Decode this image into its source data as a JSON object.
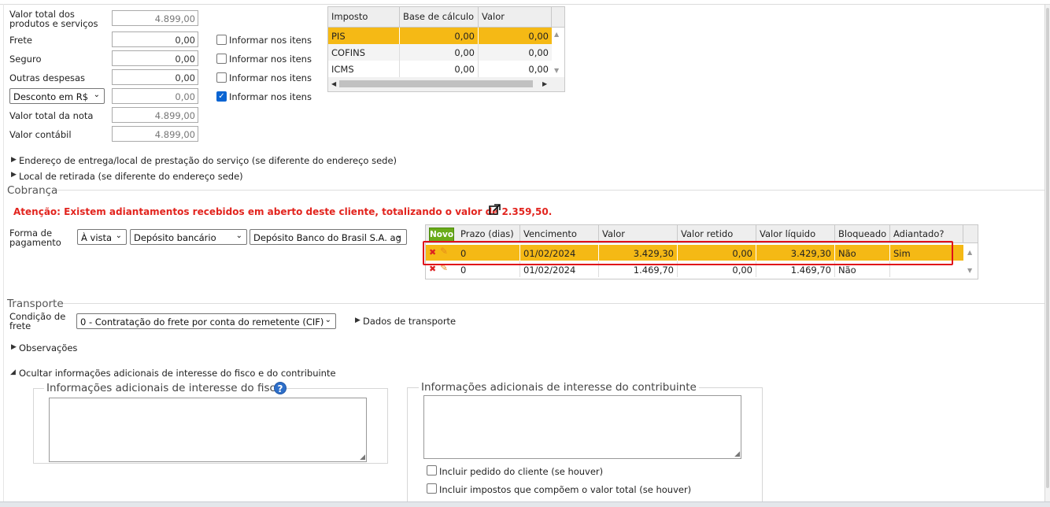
{
  "totals": {
    "valor_total_produtos_label": "Valor total dos produtos e serviços",
    "valor_total_produtos": "4.899,00",
    "frete_label": "Frete",
    "frete": "0,00",
    "seguro_label": "Seguro",
    "seguro": "0,00",
    "outras_label": "Outras despesas",
    "outras": "0,00",
    "desconto_select": "Desconto em R$",
    "desconto": "0,00",
    "valor_total_nota_label": "Valor total da nota",
    "valor_total_nota": "4.899,00",
    "valor_contabil_label": "Valor contábil",
    "valor_contabil": "4.899,00",
    "informar_label": "Informar nos itens"
  },
  "tax_grid": {
    "headers": [
      "Imposto",
      "Base de cálculo",
      "Valor"
    ],
    "rows": [
      {
        "imposto": "PIS",
        "base": "0,00",
        "valor": "0,00"
      },
      {
        "imposto": "COFINS",
        "base": "0,00",
        "valor": "0,00"
      },
      {
        "imposto": "ICMS",
        "base": "0,00",
        "valor": "0,00"
      }
    ]
  },
  "sections": {
    "endereco_entrega": "Endereço de entrega/local de prestação do serviço (se diferente do endereço sede)",
    "local_retirada": "Local de retirada (se diferente do endereço sede)",
    "cobranca": "Cobrança",
    "transporte": "Transporte",
    "observacoes": "Observações",
    "ocultar_info": "Ocultar informações adicionais de interesse do fisco e do contribuinte"
  },
  "cobranca": {
    "warning": "Atenção: Existem adiantamentos recebidos em aberto deste cliente, totalizando o valor de 2.359,50.",
    "forma_label": "Forma de pagamento",
    "forma_select": "À vista",
    "meio_select": "Depósito bancário",
    "conta_select": "Depósito Banco do Brasil S.A. ag",
    "novo_label": "Novo",
    "headers": [
      "Prazo (dias)",
      "Vencimento",
      "Valor",
      "Valor retido",
      "Valor líquido",
      "Bloqueado",
      "Adiantado?"
    ],
    "rows": [
      {
        "prazo": "0",
        "vencimento": "01/02/2024",
        "valor": "3.429,30",
        "retido": "0,00",
        "liquido": "3.429,30",
        "bloqueado": "Não",
        "adiantado": "Sim"
      },
      {
        "prazo": "0",
        "vencimento": "01/02/2024",
        "valor": "1.469,70",
        "retido": "0,00",
        "liquido": "1.469,70",
        "bloqueado": "Não",
        "adiantado": ""
      }
    ]
  },
  "transporte": {
    "condicao_label": "Condição de frete",
    "condicao_select": "0 - Contratação do frete por conta do remetente (CIF)",
    "dados_link": "Dados de transporte"
  },
  "info_adicional": {
    "fisco_legend": "Informações adicionais de interesse do fisco",
    "contribuinte_legend": "Informações adicionais de interesse do contribuinte",
    "incluir_pedido": "Incluir pedido do cliente (se houver)",
    "incluir_impostos": "Incluir impostos que compõem o valor total (se houver)"
  },
  "colors": {
    "selected_row": "#f5b915",
    "warning": "#e2241e",
    "highlight_frame": "#e0101a",
    "novo_button": "#6aab1a"
  }
}
